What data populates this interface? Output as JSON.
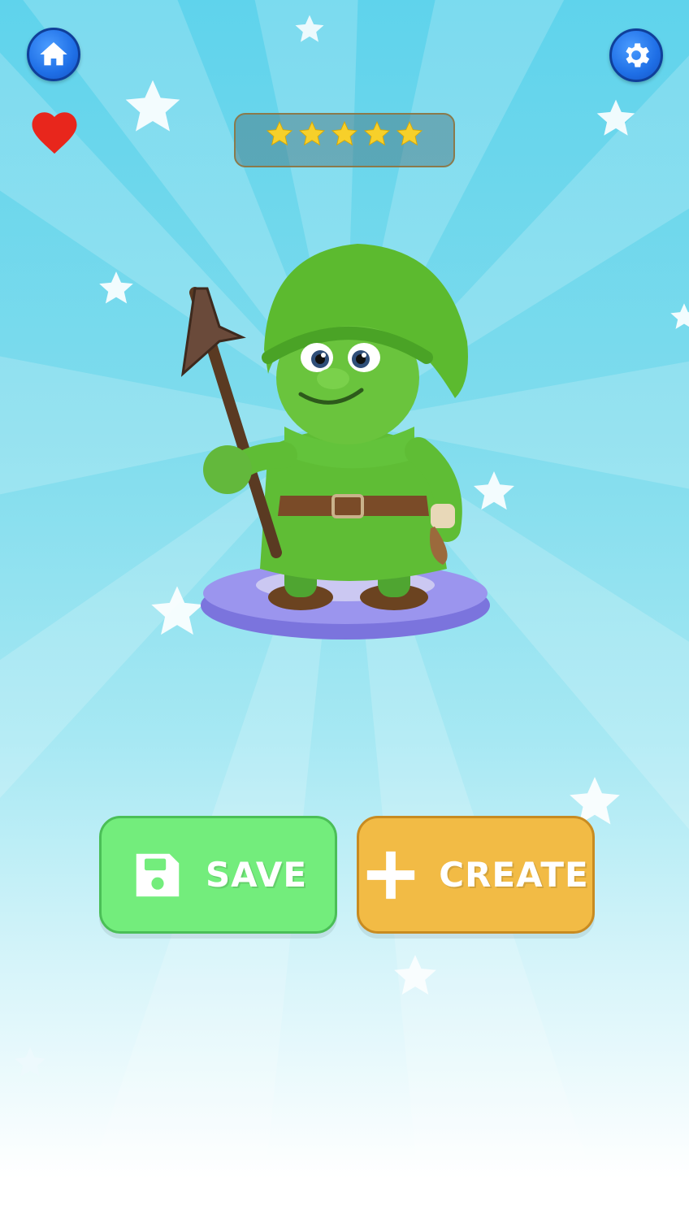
{
  "toolbar": {
    "home_icon": "home-icon",
    "settings_icon": "gear-icon",
    "favorite_icon": "heart-icon"
  },
  "rating": {
    "stars_filled": 5,
    "stars_total": 5,
    "star_color": "#f7d02a"
  },
  "character": {
    "description_icon": "green-gnome-with-axe"
  },
  "buttons": {
    "save_label": "SAVE",
    "create_label": "CREATE"
  },
  "colors": {
    "save_green": "#73ed7c",
    "create_orange": "#f2bb45",
    "accent_blue": "#1f6fe6",
    "heart_red": "#e8261c"
  }
}
